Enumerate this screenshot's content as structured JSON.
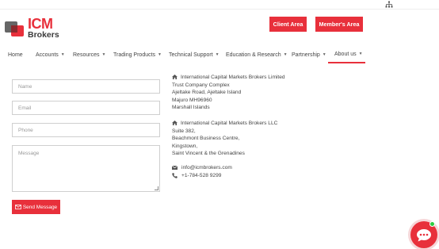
{
  "header": {
    "logo_main": "ICM",
    "logo_sub": "Brokers",
    "client_area_label": "Client Area",
    "member_area_label": "Member's Area"
  },
  "nav": {
    "items": [
      {
        "label": "Home",
        "has_arrow": false
      },
      {
        "label": "Accounts",
        "has_arrow": true
      },
      {
        "label": "Resources",
        "has_arrow": true
      },
      {
        "label": "Trading Products",
        "has_arrow": true
      },
      {
        "label": "Technical Support",
        "has_arrow": true
      },
      {
        "label": "Education & Research",
        "has_arrow": true
      },
      {
        "label": "Partnership",
        "has_arrow": true
      },
      {
        "label": "About us",
        "has_arrow": true,
        "active": true
      }
    ],
    "arrow": "▼"
  },
  "form": {
    "name_placeholder": "Name",
    "email_placeholder": "Email",
    "phone_placeholder": "Phone",
    "message_placeholder": "Message",
    "send_label": "Send Message"
  },
  "addresses": [
    {
      "lines": [
        "International Capital Markets Brokers Limited",
        "Trust Company Complex",
        "Ajeltake Road, Ajeltake Island",
        "Majuro MH96960",
        "Marshall Islands"
      ]
    },
    {
      "lines": [
        "International Capital Markets Brokers LLC",
        "Suite 382,",
        "Beachmont Business Centre,",
        "Kingstown,",
        "Saint Vincent & the Grenadines"
      ]
    }
  ],
  "contact": {
    "email": "info@icmbrokers.com",
    "phone": "+1-784-528 9299"
  },
  "colors": {
    "accent": "#e8303b",
    "online": "#2ecc40"
  },
  "icons": {
    "sitemap": "sitemap-icon",
    "home": "home-icon",
    "envelope": "envelope-icon",
    "phone": "phone-icon",
    "chat": "chat-bubble-icon"
  }
}
